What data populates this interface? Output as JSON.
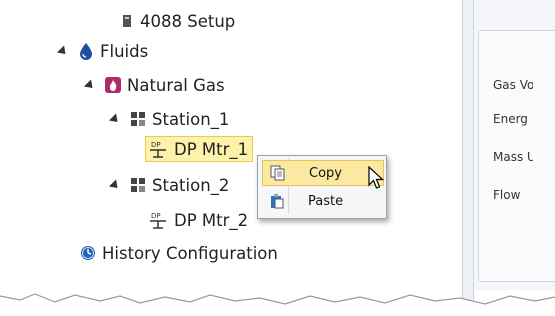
{
  "tree": {
    "top_partial": "4088 Setup",
    "fluids": "Fluids",
    "natural_gas": "Natural Gas",
    "station1": "Station_1",
    "dp_mtr1": "DP Mtr_1",
    "station2": "Station_2",
    "dp_mtr2": "DP Mtr_2",
    "history": "History Configuration"
  },
  "right_panel": {
    "labels": [
      "Gas Vo",
      "Energ",
      "Mass U",
      "Flow"
    ]
  },
  "context_menu": {
    "items": [
      "Copy",
      "Paste"
    ]
  },
  "colors": {
    "selection": "#fdf2a9",
    "menu_highlight": "#fbe9a2",
    "fluid_blue": "#1e4f9c",
    "gas_magenta": "#b0286e"
  }
}
